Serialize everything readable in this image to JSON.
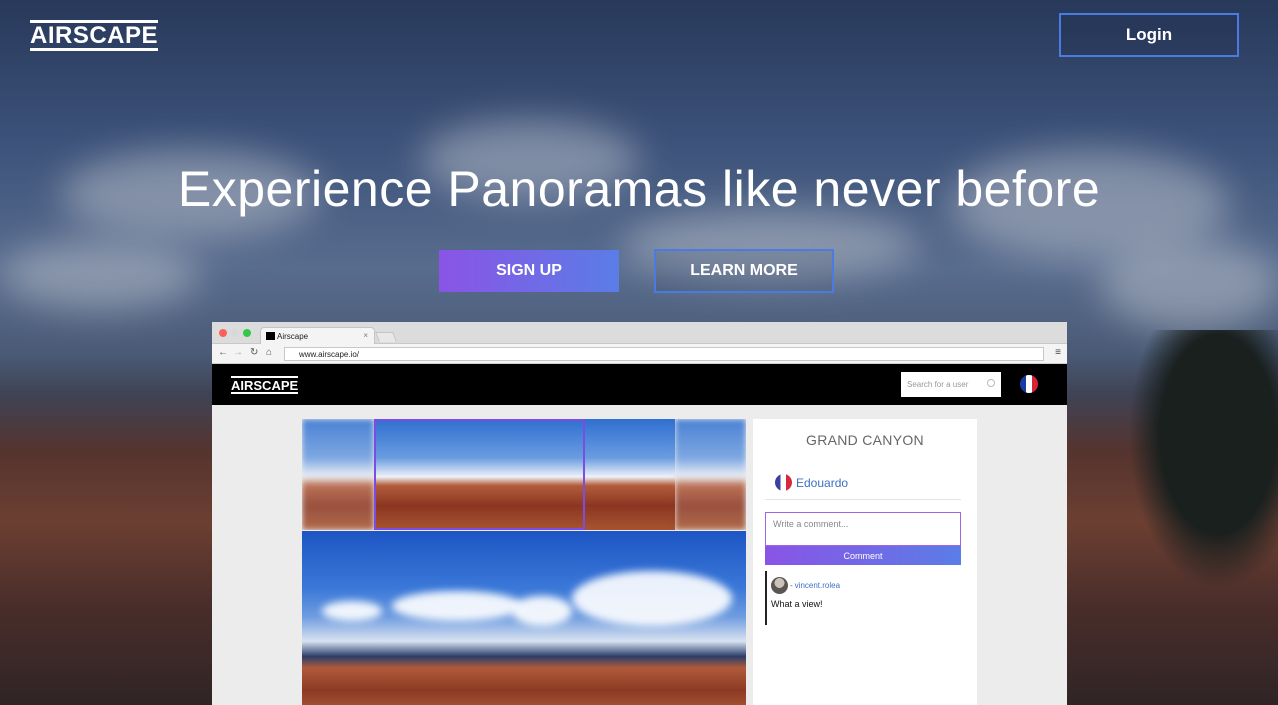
{
  "brand": {
    "logo": "AIRSCAPE"
  },
  "header": {
    "login_label": "Login"
  },
  "hero": {
    "headline": "Experience Panoramas like never before",
    "signup_label": "SIGN UP",
    "learn_more_label": "LEARN MORE"
  },
  "mockup": {
    "tab_title": "Airscape",
    "url": "www.airscape.io/",
    "app_logo": "AIRSCAPE",
    "search_placeholder": "Search for a user",
    "place_title": "GRAND CANYON",
    "owner_name": "Edouardo",
    "comment_placeholder": "Write a comment...",
    "comment_button": "Comment",
    "comments": [
      {
        "dash": "-",
        "user": "vincent.rolea",
        "text": "What a view!"
      }
    ]
  },
  "colors": {
    "accent_purple": "#8a54e6",
    "accent_blue": "#4a7be0",
    "link_blue": "#3f6fc7"
  },
  "icons": [
    "back-arrow-icon",
    "forward-arrow-icon",
    "reload-icon",
    "home-icon",
    "page-icon",
    "menu-icon",
    "search-icon",
    "france-flag-icon",
    "tab-close-icon"
  ]
}
